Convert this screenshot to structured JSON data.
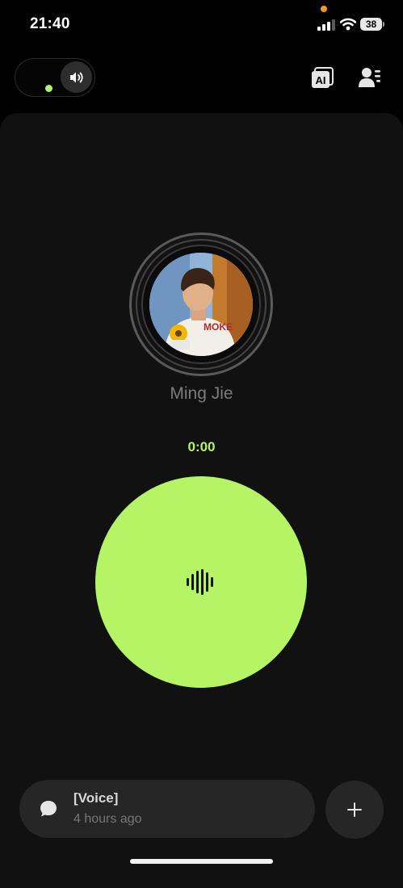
{
  "status_bar": {
    "time": "21:40",
    "battery": "38"
  },
  "header": {
    "speaker_toggle_icon": "speaker-icon",
    "ai_icon_label": "AI",
    "contact_icon": "contact-list-icon"
  },
  "call": {
    "contact_name": "Ming Jie",
    "timer": "0:00",
    "talk_icon": "sound-wave-icon"
  },
  "last_message": {
    "title": "[Voice]",
    "time": "4 hours ago",
    "icon": "chat-bubble-icon"
  },
  "colors": {
    "accent": "#b5f465",
    "background": "#000000",
    "panel": "#111111",
    "card": "#262626"
  }
}
